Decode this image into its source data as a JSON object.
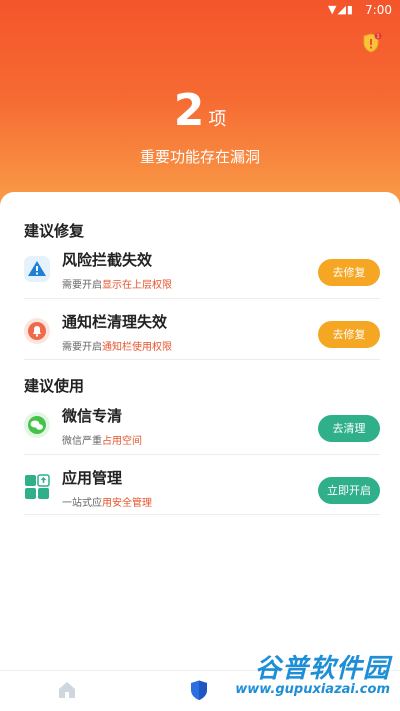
{
  "status_bar": {
    "time": "7:00"
  },
  "header": {
    "count": "2",
    "count_unit": "项",
    "subtitle": "重要功能存在漏洞",
    "badge_count": "1"
  },
  "sections": [
    {
      "title": "建议修复",
      "items": [
        {
          "title": "风险拦截失效",
          "desc_prefix": "需要开启",
          "desc_highlight": "显示在上层权限",
          "button": "去修复",
          "icon": "warning-triangle-icon"
        },
        {
          "title": "通知栏清理失效",
          "desc_prefix": "需要开启",
          "desc_highlight": "通知栏使用权限",
          "button": "去修复",
          "icon": "bell-icon"
        }
      ]
    },
    {
      "title": "建议使用",
      "items": [
        {
          "title": "微信专清",
          "desc_prefix": "微信严重",
          "desc_highlight": "占用空间",
          "button": "去清理",
          "icon": "wechat-icon"
        },
        {
          "title": "应用管理",
          "desc_prefix": "一站式应",
          "desc_highlight": "用安全管理",
          "button": "立即开启",
          "icon": "app-grid-icon"
        }
      ]
    }
  ],
  "tabbar": {
    "tabs": [
      "home-icon",
      "shield-icon"
    ]
  },
  "watermark": {
    "title": "谷普软件园",
    "url": "www.gupuxiazai.com"
  },
  "colors": {
    "accent": "#f4552b",
    "orange_button": "#f5a623",
    "green_button": "#2fb08a",
    "highlight": "#e8542c"
  }
}
